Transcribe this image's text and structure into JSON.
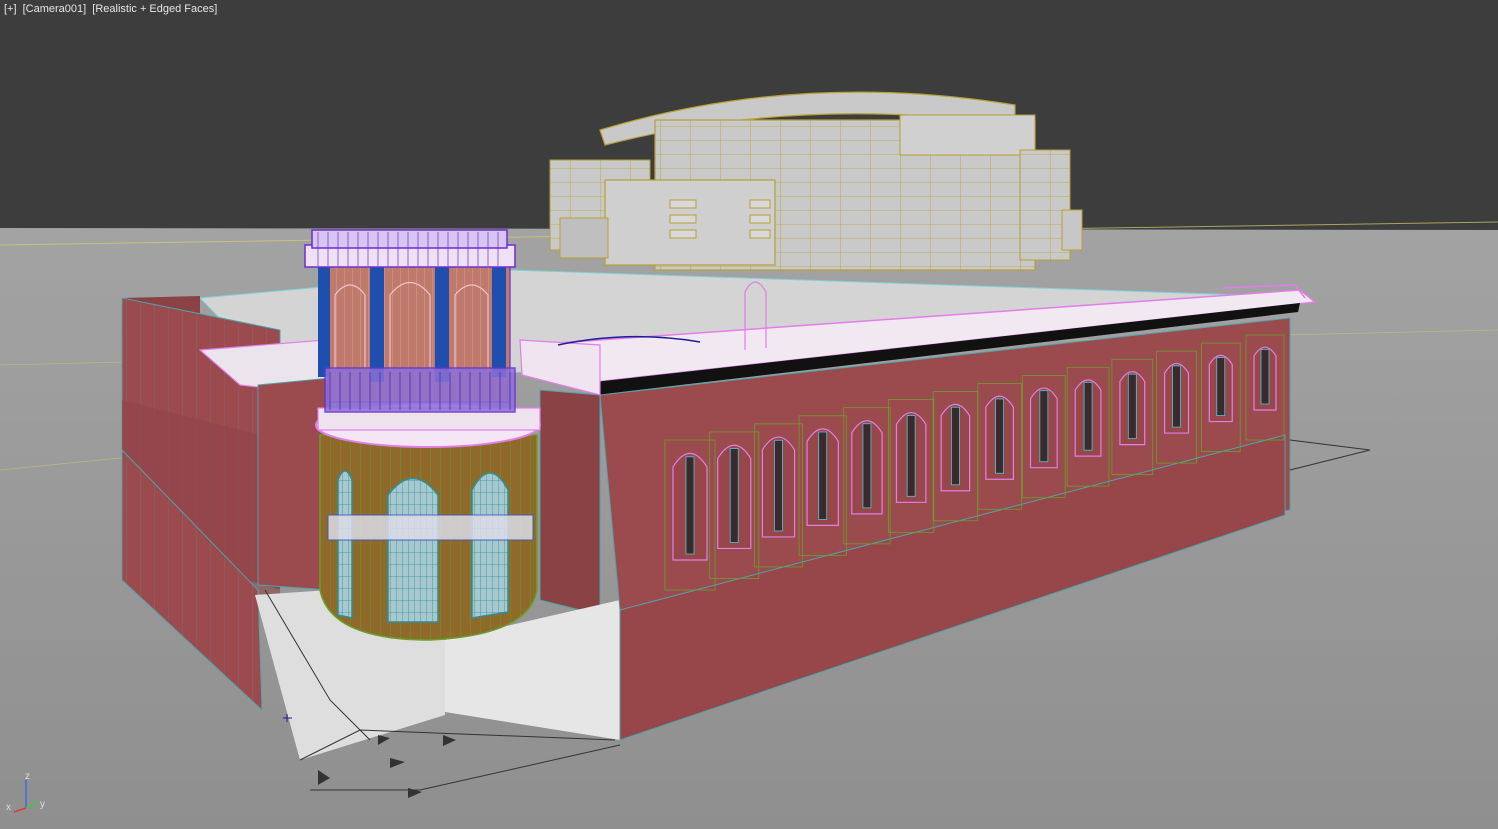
{
  "viewport": {
    "labels": {
      "menu": "[+]",
      "camera": "[Camera001]",
      "shading": "[Realistic + Edged Faces]"
    },
    "axes": {
      "x": "x",
      "y": "y",
      "z": "z"
    },
    "colors": {
      "background": "#3d3d3d",
      "ground": "#9a9a9a",
      "brick": "#9b4a4e",
      "pink_edges": "#e27ee8",
      "selection_yellow": "#b8a032",
      "cyan_edges": "#4fc7cf",
      "purple_wire": "#6a2fd0",
      "green_wire": "#6aa02a",
      "gizmo_x": "#e23a3a",
      "gizmo_y": "#3acb3a",
      "gizmo_z": "#3a6ae2"
    },
    "objects": [
      "background-stadium-building",
      "main-brick-building",
      "round-tower",
      "ground-plane"
    ]
  }
}
